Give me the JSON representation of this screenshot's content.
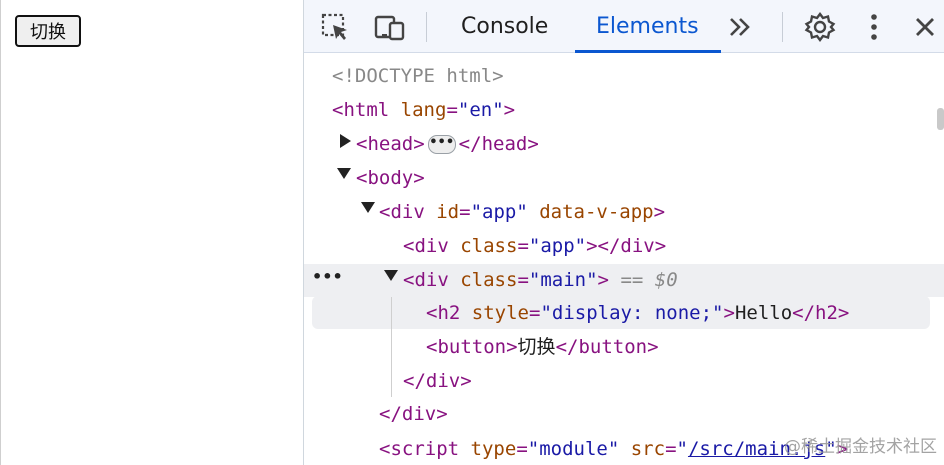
{
  "page": {
    "button_label": "切换"
  },
  "devtools": {
    "tabs": [
      {
        "label": "Console",
        "active": false
      },
      {
        "label": "Elements",
        "active": true
      }
    ],
    "accent_color": "#0b57d0"
  },
  "dom": {
    "doctype": "<!DOCTYPE html>",
    "html_tag": "html",
    "html_attr": "lang",
    "html_val": "\"en\"",
    "head_tag": "head",
    "head_close": "/head",
    "body_tag": "body",
    "div_tag": "div",
    "app_id_attr": "id",
    "app_id_val": "\"app\"",
    "app_data_attr": "data-v-app",
    "class_attr": "class",
    "app_class_val": "\"app\"",
    "div_close": "/div",
    "main_class_val": "\"main\"",
    "selected_marker": "== $0",
    "h2_tag": "h2",
    "h2_style_attr": "style",
    "h2_style_val": "\"display: none;\"",
    "h2_text": "Hello",
    "h2_close": "/h2",
    "button_tag": "button",
    "button_text": "切换",
    "button_close": "/button",
    "script_tag": "script",
    "script_type_attr": "type",
    "script_type_val": "\"module\"",
    "script_src_attr": "src",
    "script_src_q": "\"",
    "script_src_link": "/src/main.js"
  },
  "watermark": "@稀土掘金技术社区"
}
